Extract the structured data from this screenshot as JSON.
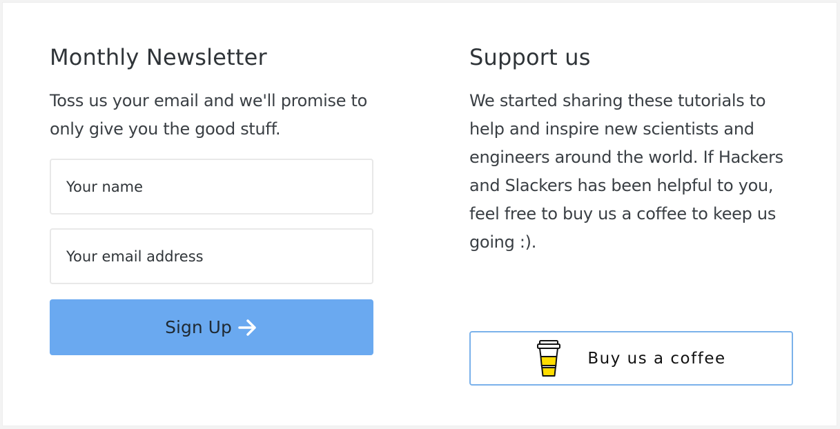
{
  "newsletter": {
    "title": "Monthly Newsletter",
    "description": "Toss us your email and we'll promise to only give you the good stuff.",
    "name_placeholder": "Your name",
    "email_placeholder": "Your email address",
    "signup_label": "Sign Up",
    "signup_icon": "arrow-right-icon",
    "button_color": "#6AA9F0"
  },
  "support": {
    "title": "Support us",
    "description": "We started sharing these tutorials to help and inspire new scientists and engineers around the world. If Hackers and Slackers has been helpful to you, feel free to buy us a coffee to keep us going :).",
    "coffee_label": "Buy us a coffee",
    "coffee_icon": "coffee-cup-icon",
    "button_border_color": "#7AB1EA"
  }
}
